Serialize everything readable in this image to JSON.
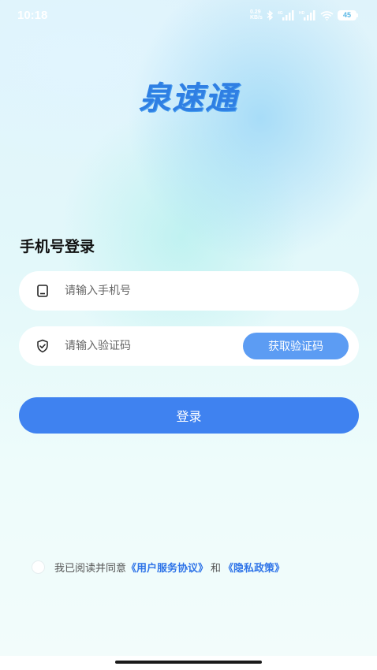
{
  "status_bar": {
    "time": "10:18",
    "net_speed_top": "0.29",
    "net_speed_bottom": "KB/s",
    "battery": "45"
  },
  "logo_text": "泉速通",
  "login": {
    "title": "手机号登录",
    "phone_placeholder": "请输入手机号",
    "code_placeholder": "请输入验证码",
    "get_code_label": "获取验证码",
    "login_button_label": "登录"
  },
  "agreement": {
    "prefix": "我已阅读并同意",
    "user_agreement": "《用户服务协议》",
    "conjunction": "和",
    "privacy_policy": "《隐私政策》"
  },
  "colors": {
    "primary": "#3f82f0",
    "get_code": "#5c9cf3",
    "link": "#2f74e8",
    "logo": "#2f7fe3"
  }
}
